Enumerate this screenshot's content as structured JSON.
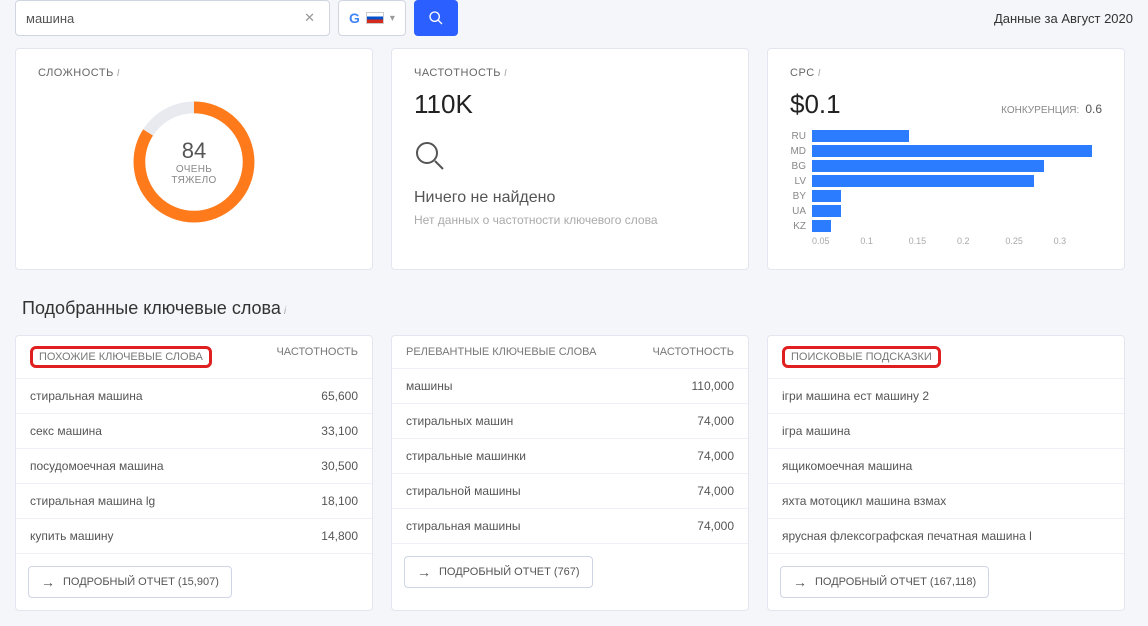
{
  "topbar": {
    "search_value": "машина",
    "data_period": "Данные за Август 2020"
  },
  "difficulty": {
    "title": "СЛОЖНОСТЬ",
    "value": "84",
    "label": "ОЧЕНЬ ТЯЖЕЛО",
    "percent": 84,
    "color": "#ff7a1a"
  },
  "volume": {
    "title": "ЧАСТОТНОСТЬ",
    "value": "110K",
    "not_found": "Ничего не найдено",
    "sub": "Нет данных о частотности ключевого слова"
  },
  "cpc": {
    "title": "CPC",
    "value": "$0.1",
    "competition_label": "КОНКУРЕНЦИЯ:",
    "competition_value": "0.6"
  },
  "chart_data": {
    "type": "bar",
    "orientation": "horizontal",
    "categories": [
      "RU",
      "MD",
      "BG",
      "LV",
      "BY",
      "UA",
      "KZ"
    ],
    "values": [
      0.1,
      0.29,
      0.24,
      0.23,
      0.03,
      0.03,
      0.02
    ],
    "xlim": [
      0,
      0.3
    ],
    "xticks": [
      0.05,
      0.1,
      0.15,
      0.2,
      0.25,
      0.3
    ]
  },
  "section_title": "Подобранные ключевые слова",
  "columns": {
    "similar": {
      "header": "ПОХОЖИЕ КЛЮЧЕВЫЕ СЛОВА",
      "metric": "ЧАСТОТНОСТЬ",
      "rows": [
        {
          "kw": "стиральная машина",
          "val": "65,600"
        },
        {
          "kw": "секс машина",
          "val": "33,100"
        },
        {
          "kw": "посудомоечная машина",
          "val": "30,500"
        },
        {
          "kw": "стиральная машина lg",
          "val": "18,100"
        },
        {
          "kw": "купить машину",
          "val": "14,800"
        }
      ],
      "report": "ПОДРОБНЫЙ ОТЧЕТ (15,907)"
    },
    "relevant": {
      "header": "РЕЛЕВАНТНЫЕ КЛЮЧЕВЫЕ СЛОВА",
      "metric": "ЧАСТОТНОСТЬ",
      "rows": [
        {
          "kw": "машины",
          "val": "110,000"
        },
        {
          "kw": "стиральных машин",
          "val": "74,000"
        },
        {
          "kw": "стиральные машинки",
          "val": "74,000"
        },
        {
          "kw": "стиральной машины",
          "val": "74,000"
        },
        {
          "kw": "стиральная машины",
          "val": "74,000"
        }
      ],
      "report": "ПОДРОБНЫЙ ОТЧЕТ (767)"
    },
    "suggestions": {
      "header": "ПОИСКОВЫЕ ПОДСКАЗКИ",
      "rows": [
        {
          "kw": "ігри машина ест машину 2"
        },
        {
          "kw": "ігра машина"
        },
        {
          "kw": "ящикомоечная машина"
        },
        {
          "kw": "яхта мотоцикл машина взмах"
        },
        {
          "kw": "ярусная флексографская печатная машина l"
        }
      ],
      "report": "ПОДРОБНЫЙ ОТЧЕТ (167,118)"
    }
  }
}
